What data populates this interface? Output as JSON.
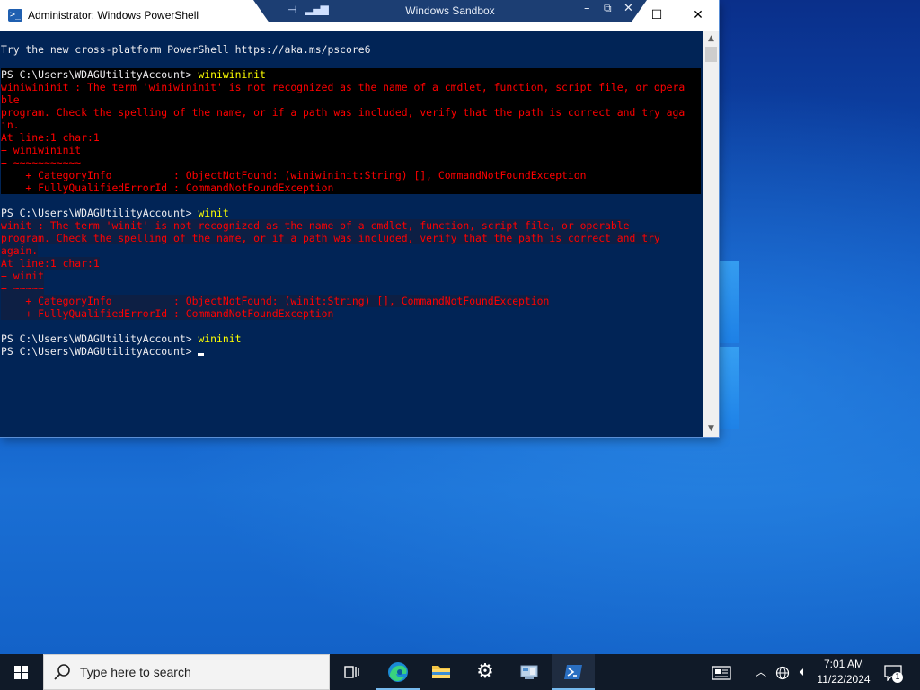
{
  "window": {
    "title": "Administrator: Windows PowerShell",
    "buttons": {
      "minimize": "—",
      "maximize": "☐",
      "close": "✕"
    }
  },
  "sandbox_bar": {
    "title": "Windows Sandbox",
    "pin_icon": "pin-icon",
    "signal_icon": "signal-bars-icon"
  },
  "console": {
    "lines": [
      {
        "text": "Try the new cross-platform PowerShell https://aka.ms/pscore6",
        "kind": "normal"
      },
      {
        "text": "",
        "kind": "normal"
      },
      {
        "prompt": "PS C:\\Users\\WDAGUtilityAccount> ",
        "cmd": "winiwininit",
        "kind": "prompt-hl"
      },
      {
        "text": "winiwininit : The term 'winiwininit' is not recognized as the name of a cmdlet, function, script file, or opera",
        "kind": "err-hl"
      },
      {
        "text": "ble",
        "kind": "err-hl"
      },
      {
        "text": "program. Check the spelling of the name, or if a path was included, verify that the path is correct and try aga",
        "kind": "err-hl"
      },
      {
        "text": "in.",
        "kind": "err-hl"
      },
      {
        "text": "At line:1 char:1",
        "kind": "err-hl"
      },
      {
        "text": "+ winiwininit",
        "kind": "err-hl"
      },
      {
        "text": "+ ~~~~~~~~~~~",
        "kind": "err-hl"
      },
      {
        "text": "    + CategoryInfo          : ObjectNotFound: (winiwininit:String) [], CommandNotFoundException",
        "kind": "err-hl"
      },
      {
        "text": "    + FullyQualifiedErrorId : CommandNotFoundException",
        "kind": "err-hl"
      },
      {
        "text": "",
        "kind": "normal"
      },
      {
        "prompt": "PS C:\\Users\\WDAGUtilityAccount> ",
        "cmd": "winit",
        "kind": "prompt"
      },
      {
        "text": "winit : The term 'winit' is not recognized as the name of a cmdlet, function, script file, or operable",
        "kind": "err-sel"
      },
      {
        "text": "program. Check the spelling of the name, or if a path was included, verify that the path is correct and try",
        "kind": "err-sel"
      },
      {
        "text": "again.",
        "kind": "err-sel"
      },
      {
        "text": "At line:1 char:1",
        "kind": "err-sel"
      },
      {
        "text": "+ winit",
        "kind": "err-sel"
      },
      {
        "text": "+ ~~~~~",
        "kind": "err-sel"
      },
      {
        "text": "    + CategoryInfo          : ObjectNotFound: (winit:String) [], CommandNotFoundException",
        "kind": "err-sel"
      },
      {
        "text": "    + FullyQualifiedErrorId : CommandNotFoundException",
        "kind": "err-sel"
      },
      {
        "text": "",
        "kind": "normal"
      },
      {
        "prompt": "PS C:\\Users\\WDAGUtilityAccount> ",
        "cmd": "wininit",
        "kind": "prompt"
      },
      {
        "prompt": "PS C:\\Users\\WDAGUtilityAccount> ",
        "cmd": "",
        "kind": "prompt-cursor"
      }
    ]
  },
  "taskbar": {
    "search_placeholder": "Type here to search",
    "apps": [
      {
        "name": "task-view-icon",
        "glyph": "⧉"
      },
      {
        "name": "edge-icon",
        "glyph": ""
      },
      {
        "name": "file-explorer-icon",
        "glyph": ""
      },
      {
        "name": "settings-icon",
        "glyph": "⚙"
      },
      {
        "name": "control-panel-icon",
        "glyph": ""
      },
      {
        "name": "powershell-icon",
        "glyph": ""
      }
    ],
    "clock": {
      "time": "7:01 AM",
      "date": "11/22/2024"
    },
    "notifications_count": "1"
  }
}
